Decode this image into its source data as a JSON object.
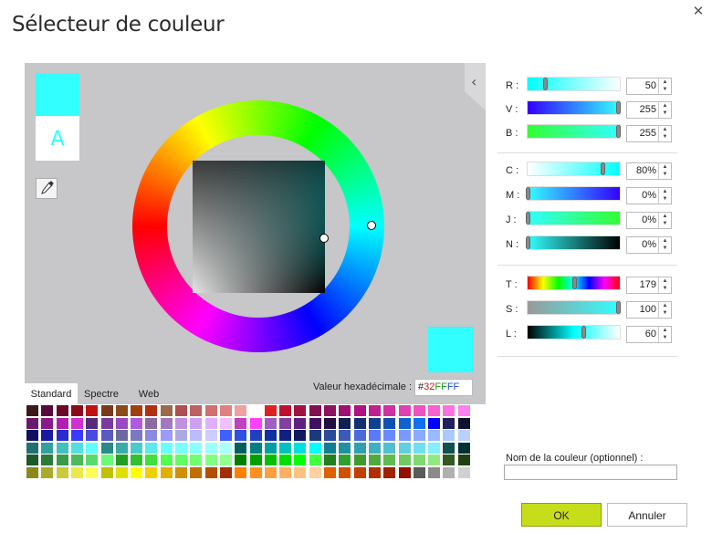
{
  "dialog": {
    "title": "Sélecteur de couleur",
    "close_icon": "close-icon"
  },
  "preview": {
    "current_color": "#32ffff",
    "a_label": "A"
  },
  "hex": {
    "label": "Valeur hexadécimale :",
    "hash": "#",
    "r": "32",
    "g": "FF",
    "b": "FF"
  },
  "tabs": [
    {
      "label": "Standard",
      "active": true
    },
    {
      "label": "Spectre",
      "active": false
    },
    {
      "label": "Web",
      "active": false
    }
  ],
  "rgb": {
    "r_label": "R :",
    "r_value": "50",
    "v_label": "V :",
    "v_value": "255",
    "b_label": "B :",
    "b_value": "255"
  },
  "cmyk": {
    "c_label": "C :",
    "c_value": "80%",
    "m_label": "M :",
    "m_value": "0%",
    "j_label": "J :",
    "j_value": "0%",
    "n_label": "N :",
    "n_value": "0%"
  },
  "hsl": {
    "t_label": "T :",
    "t_value": "179",
    "s_label": "S :",
    "s_value": "100",
    "l_label": "L :",
    "l_value": "60"
  },
  "name_field": {
    "label": "Nom de la couleur (optionnel) :",
    "value": ""
  },
  "buttons": {
    "ok": "OK",
    "cancel": "Annuler"
  },
  "palette_rows": [
    [
      "#3a1a1a",
      "#5a0a3a",
      "#6a0a2a",
      "#8a0a1a",
      "#c01010",
      "#7a3a1a",
      "#8a4a1a",
      "#a04010",
      "#b03010",
      "#9a6a4a",
      "#b05050",
      "#c06060",
      "#d07070",
      "#e08080",
      "#f0a0a0",
      "#ffffff",
      "#e02020",
      "#c01030",
      "#a01040",
      "#801050",
      "#901060",
      "#a01070",
      "#b01080",
      "#c02090",
      "#d030a0",
      "#e040b0",
      "#f050c0",
      "#fa60d0",
      "#ff70e0",
      "#ff80f0"
    ],
    [
      "#6a1a6a",
      "#8a1a8a",
      "#b020b0",
      "#d030d0",
      "#5a2a7a",
      "#7a3aa0",
      "#9a4ac0",
      "#b05ae0",
      "#8a6aa0",
      "#a07ac0",
      "#c090e0",
      "#d0a0f0",
      "#e0b0ff",
      "#f0c0ff",
      "#c040c0",
      "#ff40ff",
      "#a060c0",
      "#8040a0",
      "#602080",
      "#401060",
      "#201040",
      "#102050",
      "#103070",
      "#104090",
      "#1050b0",
      "#1060d0",
      "#1070f0",
      "#0000ff",
      "#202060",
      "#101030"
    ],
    [
      "#101060",
      "#1a1aa0",
      "#2a2ad0",
      "#3a3aff",
      "#4a4ae0",
      "#5a5ac0",
      "#6a6aa0",
      "#7a7ac0",
      "#8a8ae0",
      "#9a9aff",
      "#aaaae0",
      "#bbbbff",
      "#ccccff",
      "#4060ff",
      "#3050e0",
      "#2040c0",
      "#1030a0",
      "#102080",
      "#101a60",
      "#1a3a7a",
      "#2a4a9a",
      "#3a5aba",
      "#4a6ada",
      "#5a7afa",
      "#6a8aff",
      "#7a9aff",
      "#8aaaff",
      "#9abaff",
      "#aacaff",
      "#bad0ff"
    ],
    [
      "#207070",
      "#30a0a0",
      "#40c0c0",
      "#50e0e0",
      "#60ffff",
      "#2a8a8a",
      "#3aaaaa",
      "#4acaca",
      "#5aeaea",
      "#6affff",
      "#7affff",
      "#8affff",
      "#9affff",
      "#aaffff",
      "#006060",
      "#008080",
      "#00a0a0",
      "#00c0c0",
      "#00e0e0",
      "#00ffff",
      "#108090",
      "#2090a0",
      "#30a0b0",
      "#40b0c0",
      "#50c0d0",
      "#60d0e0",
      "#70e0f0",
      "#80f0ff",
      "#105050",
      "#003030"
    ],
    [
      "#1a5a2a",
      "#2a7a3a",
      "#3a9a4a",
      "#4aba5a",
      "#5ada6a",
      "#6afa7a",
      "#20a020",
      "#30c030",
      "#40e040",
      "#50ff50",
      "#60ff60",
      "#70ff70",
      "#80ff80",
      "#90ff90",
      "#008000",
      "#00a000",
      "#00c000",
      "#00e000",
      "#00ff00",
      "#40ff40",
      "#208020",
      "#30a030",
      "#409a30",
      "#50aa40",
      "#60ba50",
      "#70ca60",
      "#80da70",
      "#90ea80",
      "#305a20",
      "#204010"
    ],
    [
      "#8a8a1a",
      "#aaaa2a",
      "#caca3a",
      "#eaea4a",
      "#ffff5a",
      "#c0c000",
      "#e0e000",
      "#ffff00",
      "#f0d000",
      "#e0b000",
      "#d09000",
      "#c07000",
      "#b05000",
      "#a03000",
      "#ff8000",
      "#ff9020",
      "#ffa040",
      "#ffb060",
      "#ffc080",
      "#ffd0a0",
      "#e06000",
      "#d05000",
      "#c04000",
      "#b03000",
      "#a02000",
      "#901000",
      "#5a5a5a",
      "#8a8a8a",
      "#b0b0b0",
      "#d0d0d0"
    ]
  ]
}
